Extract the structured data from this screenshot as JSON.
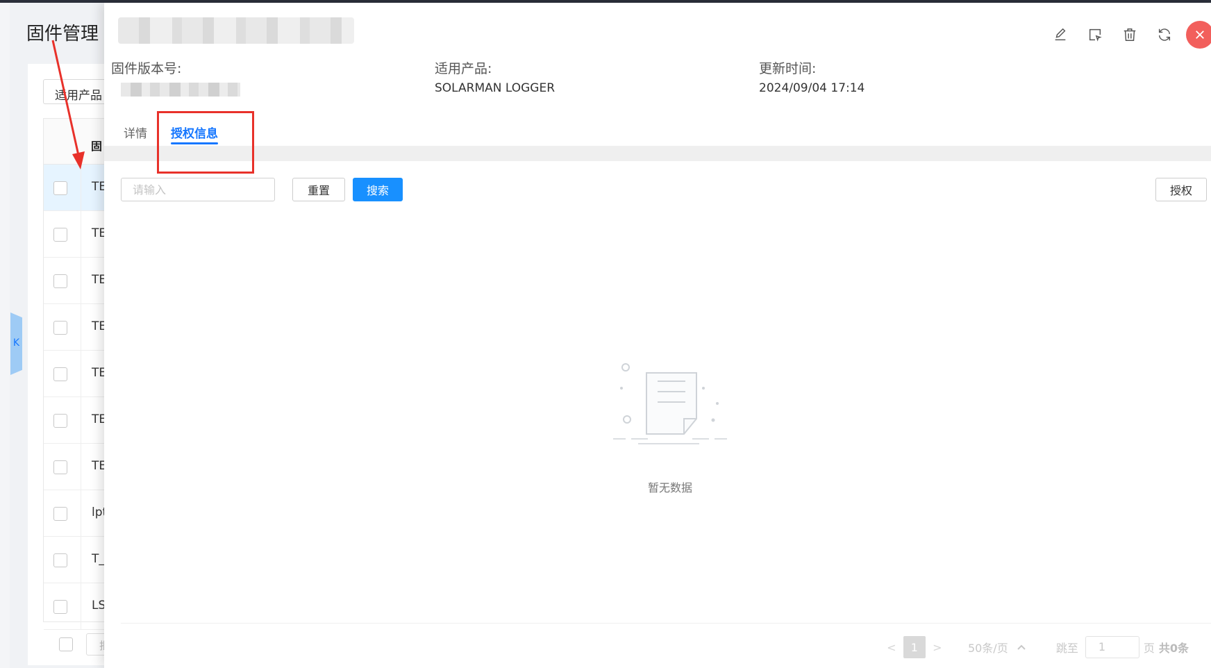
{
  "background": {
    "page_title": "固件管理",
    "filter_label": "适用产品",
    "table_header_fragment": "固",
    "rows": [
      "TE",
      "TE",
      "TE",
      "TE",
      "TE",
      "TE",
      "TE",
      "lpt",
      "T_",
      "LS"
    ],
    "footer_fragment": "批",
    "collapse_glyph": "K"
  },
  "drawer": {
    "fields": {
      "version_label": "固件版本号:",
      "product_label": "适用产品:",
      "product_value": "SOLARMAN LOGGER",
      "updated_label": "更新时间:",
      "updated_value": "2024/09/04 17:14"
    },
    "tabs": [
      {
        "label": "详情",
        "active": false
      },
      {
        "label": "授权信息",
        "active": true
      }
    ],
    "search": {
      "placeholder": "请输入",
      "reset_label": "重置",
      "search_label": "搜索",
      "authorize_label": "授权"
    },
    "empty_text": "暂无数据",
    "pager": {
      "prev": "<",
      "current": "1",
      "next": ">",
      "page_size": "50条/页",
      "jump_label": "跳至",
      "jump_value": "1",
      "page_suffix": "页",
      "total": "共0条"
    },
    "icons": [
      "edit-icon",
      "select-icon",
      "trash-icon",
      "refresh-icon",
      "close-icon"
    ]
  },
  "colors": {
    "primary": "#1890ff",
    "active_tab": "#1677ff",
    "close": "#f25f5c",
    "annotation": "#e8312a"
  }
}
